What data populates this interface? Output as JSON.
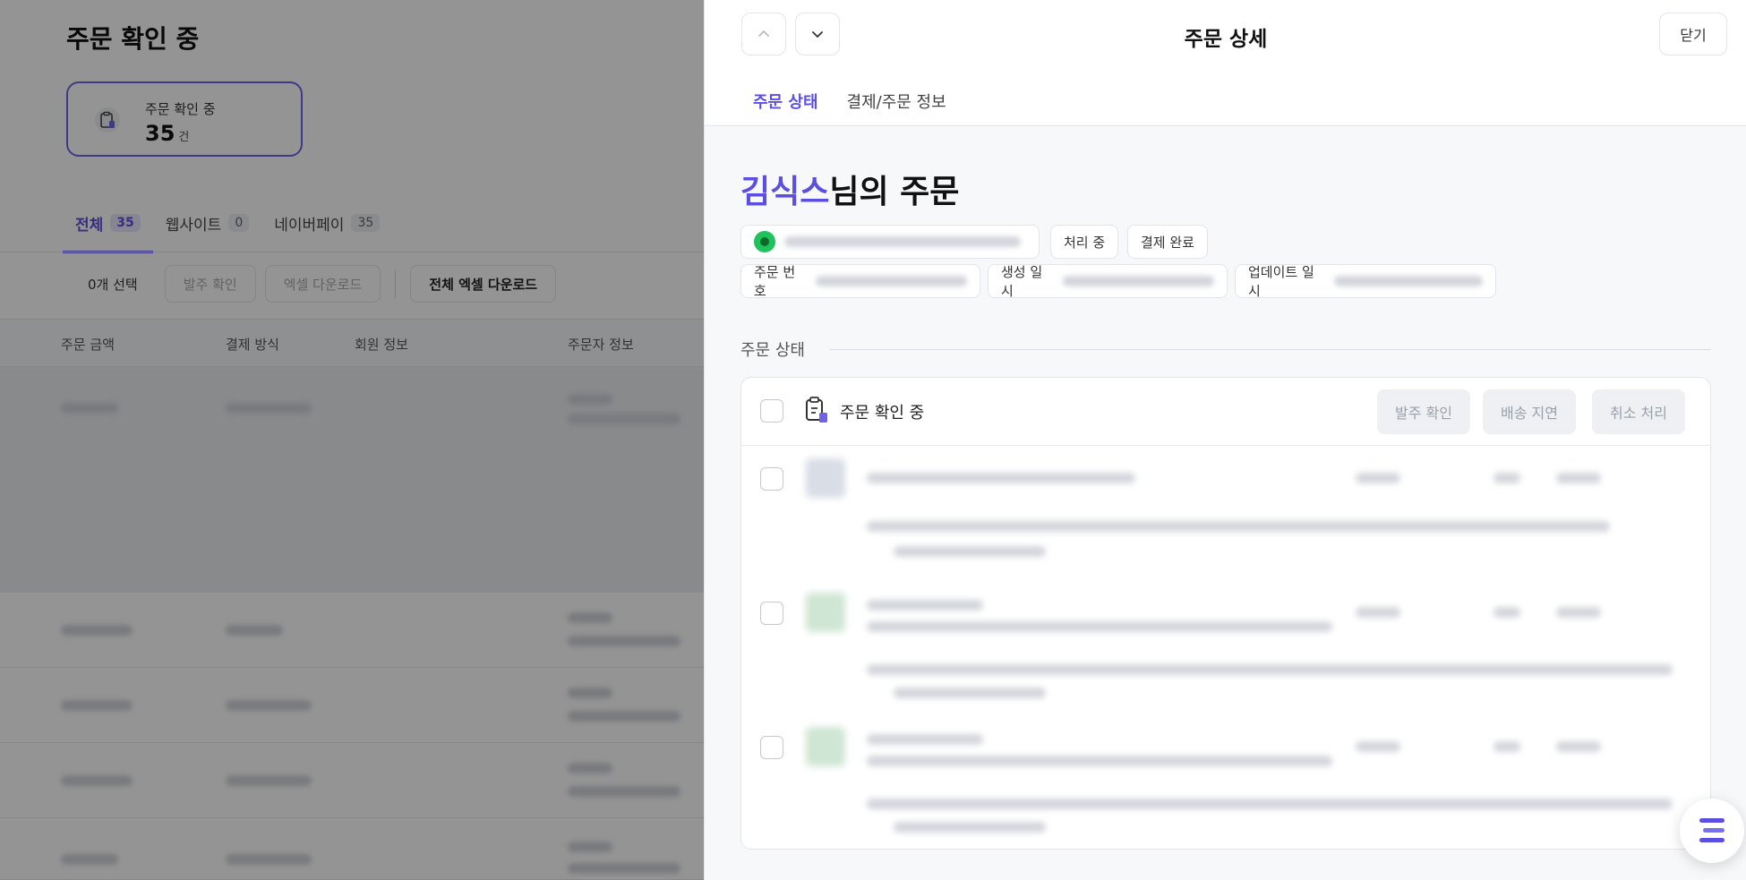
{
  "background_page": {
    "title": "주문 확인 중",
    "summary": {
      "label": "주문 확인 중",
      "count": "35",
      "unit": "건",
      "icon": "clipboard-clock-icon"
    },
    "filter_tabs": [
      {
        "label": "전체",
        "count": "35",
        "active": true
      },
      {
        "label": "웹사이트",
        "count": "0",
        "active": false
      },
      {
        "label": "네이버페이",
        "count": "35",
        "active": false
      }
    ],
    "toolbar": {
      "selected": "0개 선택",
      "confirm_label": "발주 확인",
      "excel_label": "엑셀 다운로드",
      "excel_all_label": "전체 엑셀 다운로드"
    },
    "columns": [
      "주문 금액",
      "결제 방식",
      "회원 정보",
      "주문자 정보"
    ]
  },
  "drawer": {
    "title": "주문 상세",
    "close_label": "닫기",
    "prev_icon": "chevron-up-icon",
    "next_icon": "chevron-down-icon",
    "tabs": [
      {
        "label": "주문 상태",
        "active": true
      },
      {
        "label": "결제/주문 정보",
        "active": false
      }
    ],
    "customer_name": "김식스",
    "headline_suffix": "님의 주문",
    "status_chips": [
      "처리 중",
      "결제 완료"
    ],
    "meta_labels": {
      "order_no": "주문 번호",
      "created": "생성 일시",
      "updated": "업데이트 일시"
    },
    "section_title": "주문 상태",
    "panel": {
      "status_label": "주문 확인 중",
      "actions": [
        "발주 확인",
        "배송 지연",
        "취소 처리"
      ]
    },
    "colors": {
      "accent": "#5a4fe0",
      "brand_green": "#1fc35c"
    }
  },
  "fab_icon": "menu-lines-icon"
}
